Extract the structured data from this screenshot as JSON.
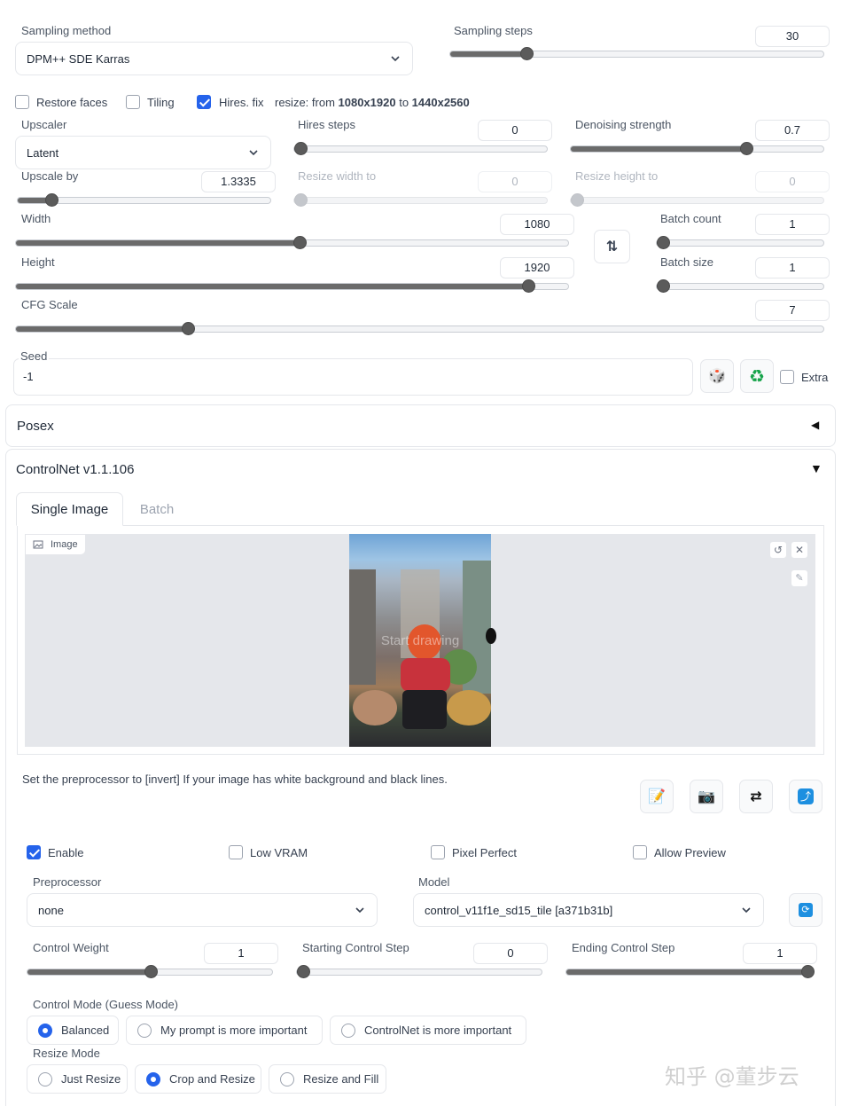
{
  "sampling": {
    "method_label": "Sampling method",
    "method_value": "DPM++ SDE Karras",
    "steps_label": "Sampling steps",
    "steps_value": "30",
    "steps_fraction": 0.17
  },
  "hires": {
    "restore_faces": "Restore faces",
    "tiling": "Tiling",
    "hires_fix": "Hires. fix",
    "resize_prefix": "resize: from ",
    "resize_from": "1080x1920",
    "resize_to_word": " to ",
    "resize_to": "1440x2560",
    "upscaler_label": "Upscaler",
    "upscaler_value": "Latent",
    "hires_steps_label": "Hires steps",
    "hires_steps_value": "0",
    "denoise_label": "Denoising strength",
    "denoise_value": "0.7",
    "upscale_by_label": "Upscale by",
    "upscale_by_value": "1.3335",
    "resize_width_label": "Resize width to",
    "resize_width_value": "0",
    "resize_height_label": "Resize height to",
    "resize_height_value": "0"
  },
  "size": {
    "width_label": "Width",
    "width_value": "1080",
    "height_label": "Height",
    "height_value": "1920",
    "batch_count_label": "Batch count",
    "batch_count_value": "1",
    "batch_size_label": "Batch size",
    "batch_size_value": "1",
    "swap_icon": "⇅"
  },
  "cfg": {
    "label": "CFG Scale",
    "value": "7"
  },
  "seed": {
    "label": "Seed",
    "value": "-1",
    "dice_icon": "🎲",
    "recycle_icon": "♻",
    "extra_label": "Extra"
  },
  "posex": {
    "title": "Posex",
    "arrow": "◀"
  },
  "controlnet": {
    "title": "ControlNet v1.1.106",
    "arrow": "▼",
    "tabs": [
      "Single Image",
      "Batch"
    ],
    "image_label": "Image",
    "canvas_hint": "Start drawing",
    "hint": "Set the preprocessor to [invert] If your image has white background and black lines.",
    "tool_icons": [
      "📝",
      "📷",
      "⇄",
      "⤴"
    ],
    "enable": "Enable",
    "low_vram": "Low VRAM",
    "pixel_perfect": "Pixel Perfect",
    "allow_preview": "Allow Preview",
    "preprocessor_label": "Preprocessor",
    "preprocessor_value": "none",
    "model_label": "Model",
    "model_value": "control_v11f1e_sd15_tile [a371b31b]",
    "refresh_icon": "🔄",
    "weight_label": "Control Weight",
    "weight_value": "1",
    "start_label": "Starting Control Step",
    "start_value": "0",
    "end_label": "Ending Control Step",
    "end_value": "1",
    "control_mode_label": "Control Mode (Guess Mode)",
    "control_modes": [
      "Balanced",
      "My prompt is more important",
      "ControlNet is more important"
    ],
    "resize_mode_label": "Resize Mode",
    "resize_modes": [
      "Just Resize",
      "Crop and Resize",
      "Resize and Fill"
    ]
  },
  "watermark": "知乎 @董步云",
  "colors": {
    "accent": "#2563eb",
    "slider": "#5b5b5b",
    "canvas": "#e5e7eb"
  }
}
